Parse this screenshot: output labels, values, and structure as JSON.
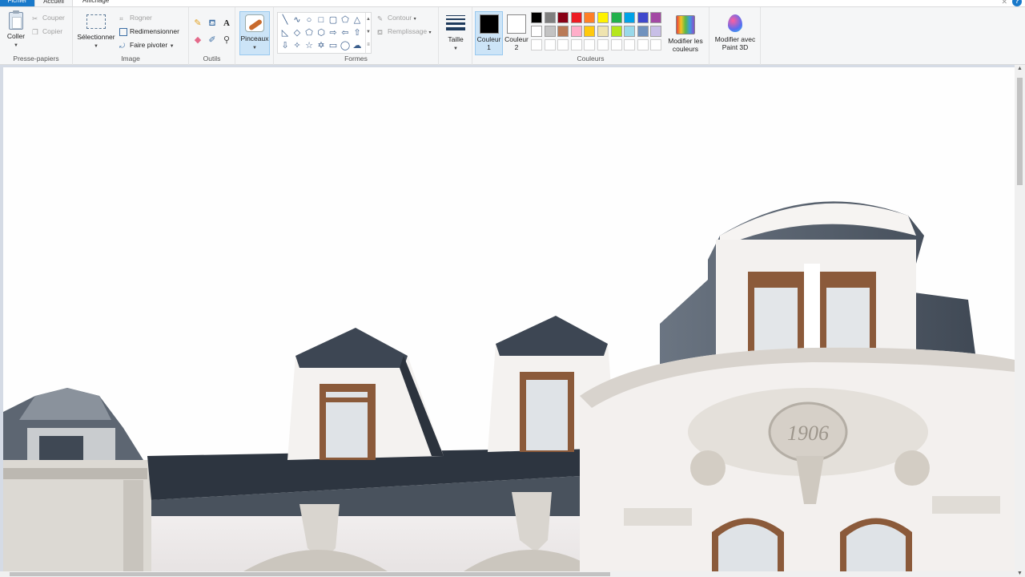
{
  "tabs": {
    "file": "Fichier",
    "home": "Accueil",
    "view": "Affichage"
  },
  "window": {
    "close_glyph": "✕",
    "help_glyph": "?"
  },
  "clipboard": {
    "paste": "Coller",
    "cut": "Couper",
    "copy": "Copier",
    "label": "Presse-papiers"
  },
  "image": {
    "select": "Sélectionner",
    "crop": "Rogner",
    "resize": "Redimensionner",
    "rotate": "Faire pivoter",
    "label": "Image"
  },
  "tools": {
    "label": "Outils",
    "icons": [
      "pencil-icon",
      "fill-icon",
      "text-icon",
      "eraser-icon",
      "color-picker-icon",
      "magnifier-icon"
    ]
  },
  "brushes": {
    "label": "Pinceaux"
  },
  "shapes": {
    "label": "Formes",
    "outline": "Contour",
    "fill": "Remplissage"
  },
  "size": {
    "label": "Taille"
  },
  "colors": {
    "color1": "Couleur 1",
    "color2": "Couleur 2",
    "color1_value": "#000000",
    "color2_value": "#ffffff",
    "edit": "Modifier les couleurs",
    "label": "Couleurs",
    "palette_row1": [
      "#000000",
      "#7f7f7f",
      "#880015",
      "#ed1c24",
      "#ff7f27",
      "#fff200",
      "#22b14c",
      "#00a2e8",
      "#3f48cc",
      "#a349a4"
    ],
    "palette_row2": [
      "#ffffff",
      "#c3c3c3",
      "#b97a57",
      "#ffaec9",
      "#ffc90e",
      "#efe4b0",
      "#b5e61d",
      "#99d9ea",
      "#7092be",
      "#c8bfe7"
    ],
    "palette_row3": [
      "#ffffff",
      "#ffffff",
      "#ffffff",
      "#ffffff",
      "#ffffff",
      "#ffffff",
      "#ffffff",
      "#ffffff",
      "#ffffff",
      "#ffffff"
    ]
  },
  "paint3d": {
    "label": "Modifier avec Paint 3D"
  },
  "canvas_text": {
    "medallion_date": "1906"
  }
}
